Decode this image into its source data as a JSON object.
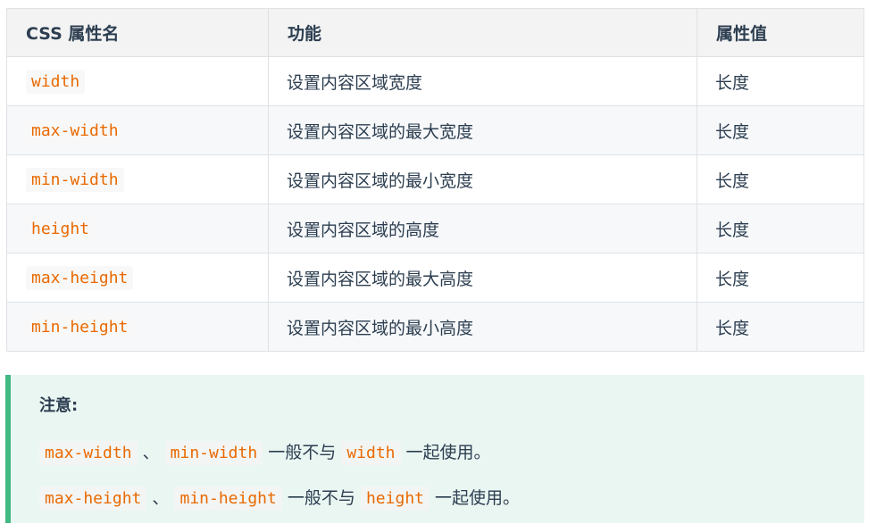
{
  "table": {
    "headers": [
      "CSS 属性名",
      "功能",
      "属性值"
    ],
    "rows": [
      {
        "prop": "width",
        "func": "设置内容区域宽度",
        "value": "长度"
      },
      {
        "prop": "max-width",
        "func": "设置内容区域的最大宽度",
        "value": "长度"
      },
      {
        "prop": "min-width",
        "func": "设置内容区域的最小宽度",
        "value": "长度"
      },
      {
        "prop": "height",
        "func": "设置内容区域的高度",
        "value": "长度"
      },
      {
        "prop": "max-height",
        "func": "设置内容区域的最大高度",
        "value": "长度"
      },
      {
        "prop": "min-height",
        "func": "设置内容区域的最小高度",
        "value": "长度"
      }
    ]
  },
  "note": {
    "title": "注意:",
    "line1": {
      "code_a": "max-width",
      "sep": "、",
      "code_b": "min-width",
      "text_mid": "一般不与",
      "code_c": "width",
      "text_end": "一起使用。"
    },
    "line2": {
      "code_a": "max-height",
      "sep": "、",
      "code_b": "min-height",
      "text_mid": "一般不与",
      "code_c": "height",
      "text_end": "一起使用。"
    }
  },
  "colors": {
    "code_text": "#e96900",
    "note_border": "#42b983",
    "note_background": "#eaf6f2",
    "header_background": "#f3f3f3",
    "stripe_background": "#f6f8fa"
  }
}
